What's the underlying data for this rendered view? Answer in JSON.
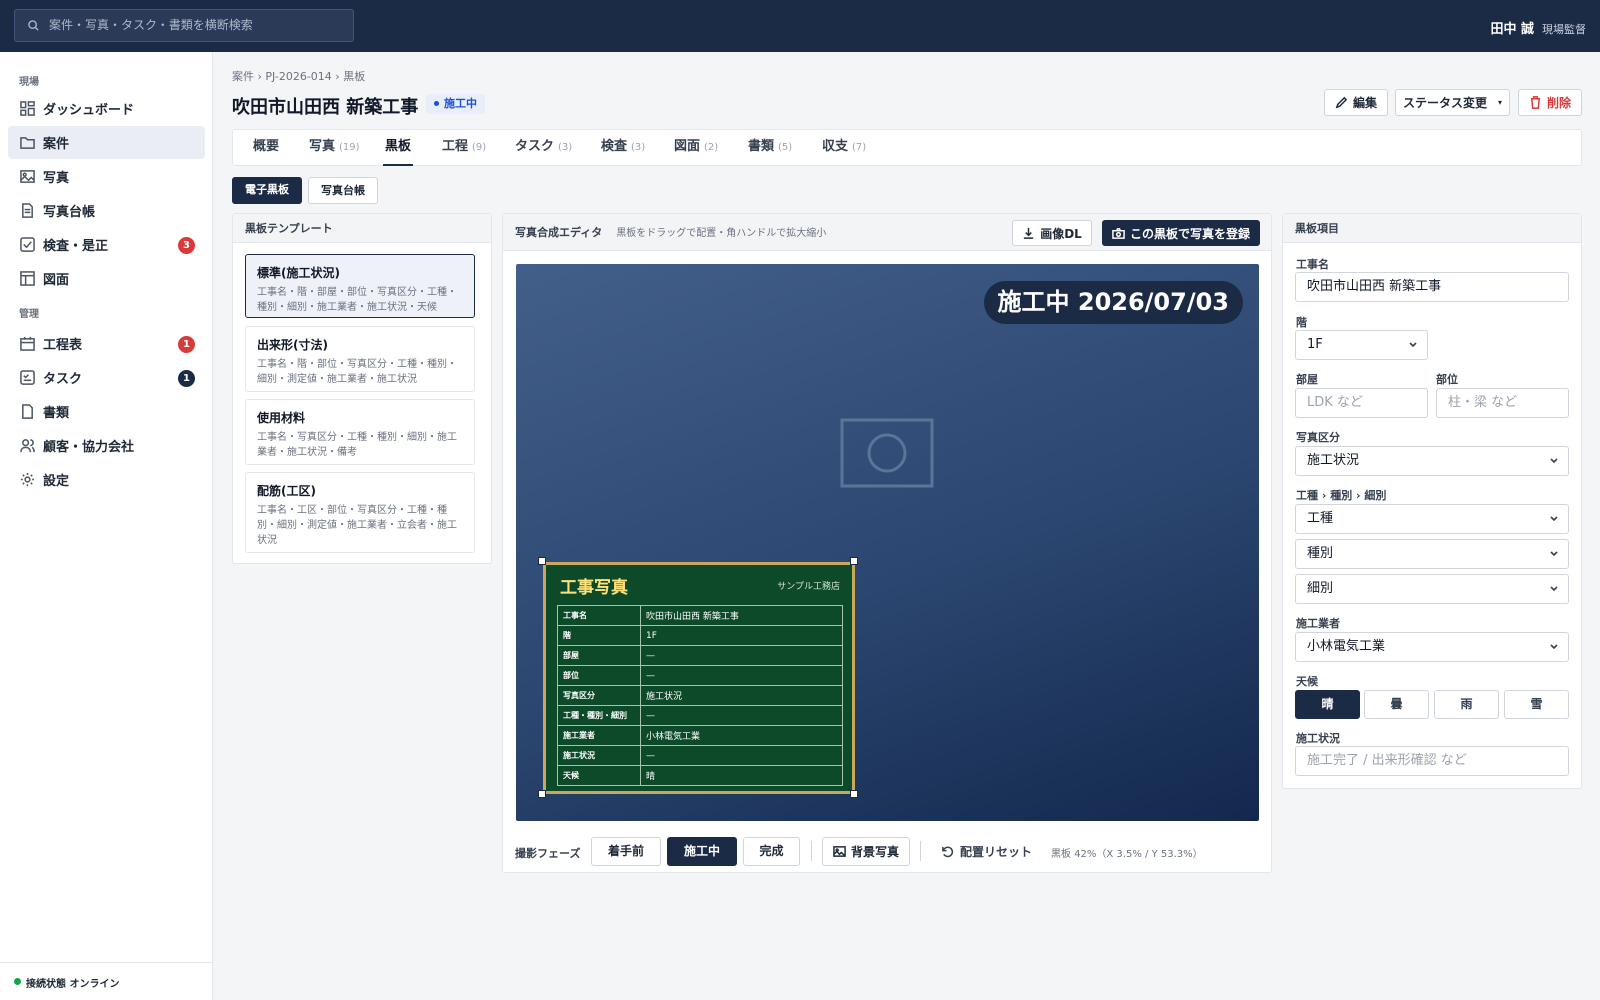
{
  "header": {
    "search_placeholder": "案件・写真・タスク・書類を横断検索",
    "user_name": "田中 誠",
    "user_role": "現場監督"
  },
  "sidebar": {
    "section_site": "現場",
    "section_manage": "管理",
    "items": [
      {
        "label": "ダッシュボード"
      },
      {
        "label": "案件"
      },
      {
        "label": "写真"
      },
      {
        "label": "写真台帳"
      },
      {
        "label": "検査・是正",
        "badge": "3"
      },
      {
        "label": "図面"
      },
      {
        "label": "工程表",
        "badge": "1"
      },
      {
        "label": "タスク",
        "badge": "1"
      },
      {
        "label": "書類"
      },
      {
        "label": "顧客・協力会社"
      },
      {
        "label": "設定"
      }
    ],
    "connection": "接続状態 オンライン",
    "colors": {
      "badge_red": "#d93a3a",
      "badge_navy": "#1b2a45"
    }
  },
  "page": {
    "breadcrumb": "案件 › PJ-2026-014 › 黒板",
    "title": "吹田市山田西 新築工事",
    "status": "施工中",
    "actions": {
      "edit": "編集",
      "status_change": "ステータス変更",
      "delete": "削除"
    }
  },
  "tabs": [
    {
      "label": "概要",
      "count": ""
    },
    {
      "label": "写真",
      "count": "(19)"
    },
    {
      "label": "黒板",
      "count": ""
    },
    {
      "label": "工程",
      "count": "(9)"
    },
    {
      "label": "タスク",
      "count": "(3)"
    },
    {
      "label": "検査",
      "count": "(3)"
    },
    {
      "label": "図面",
      "count": "(2)"
    },
    {
      "label": "書類",
      "count": "(5)"
    },
    {
      "label": "収支",
      "count": "(7)"
    }
  ],
  "subtabs": {
    "board": "電子黒板",
    "ledger": "写真台帳"
  },
  "templates": {
    "title": "黒板テンプレート",
    "items": [
      {
        "name": "標準(施工状況)",
        "desc": "工事名・階・部屋・部位・写真区分・工種・種別・細別・施工業者・施工状況・天候"
      },
      {
        "name": "出来形(寸法)",
        "desc": "工事名・階・部位・写真区分・工種・種別・細別・測定値・施工業者・施工状況"
      },
      {
        "name": "使用材料",
        "desc": "工事名・写真区分・工種・種別・細別・施工業者・施工状況・備考"
      },
      {
        "name": "配筋(工区)",
        "desc": "工事名・工区・部位・写真区分・工種・種別・細別・測定値・施工業者・立会者・施工状況"
      }
    ]
  },
  "editor": {
    "title": "写真合成エディタ",
    "hint": "黒板をドラッグで配置・角ハンドルで拡大縮小",
    "download": "画像DL",
    "register": "この黒板で写真を登録",
    "overlay": "施工中 2026/07/03",
    "board": {
      "title": "工事写真",
      "company": "サンプル工務店",
      "rows": [
        {
          "k": "工事名",
          "v": "吹田市山田西 新築工事"
        },
        {
          "k": "階",
          "v": "1F"
        },
        {
          "k": "部屋",
          "v": "—"
        },
        {
          "k": "部位",
          "v": "—"
        },
        {
          "k": "写真区分",
          "v": "施工状況"
        },
        {
          "k": "工種・種別・細別",
          "v": "—"
        },
        {
          "k": "施工業者",
          "v": "小林電気工業"
        },
        {
          "k": "施工状況",
          "v": "—"
        },
        {
          "k": "天候",
          "v": "晴"
        }
      ]
    },
    "phase_label": "撮影フェーズ",
    "phases": [
      "着手前",
      "施工中",
      "完成"
    ],
    "bg_photo": "背景写真",
    "reset": "配置リセット",
    "readout": "黒板 42%（X 3.5% / Y 53.3%）"
  },
  "fields": {
    "title": "黒板項目",
    "koji_label": "工事名",
    "koji_value": "吹田市山田西 新築工事",
    "floor_label": "階",
    "floor_value": "1F",
    "room_label": "部屋",
    "room_placeholder": "LDK など",
    "part_label": "部位",
    "part_placeholder": "柱・梁 など",
    "photo_type_label": "写真区分",
    "photo_type_value": "施工状況",
    "work_label": "工種 › 種別 › 細別",
    "work_values": [
      "工種",
      "種別",
      "細別"
    ],
    "contractor_label": "施工業者",
    "contractor_value": "小林電気工業",
    "weather_label": "天候",
    "weather": [
      "晴",
      "曇",
      "雨",
      "雪"
    ],
    "status_label": "施工状況",
    "status_placeholder": "施工完了 / 出来形確認 など"
  }
}
